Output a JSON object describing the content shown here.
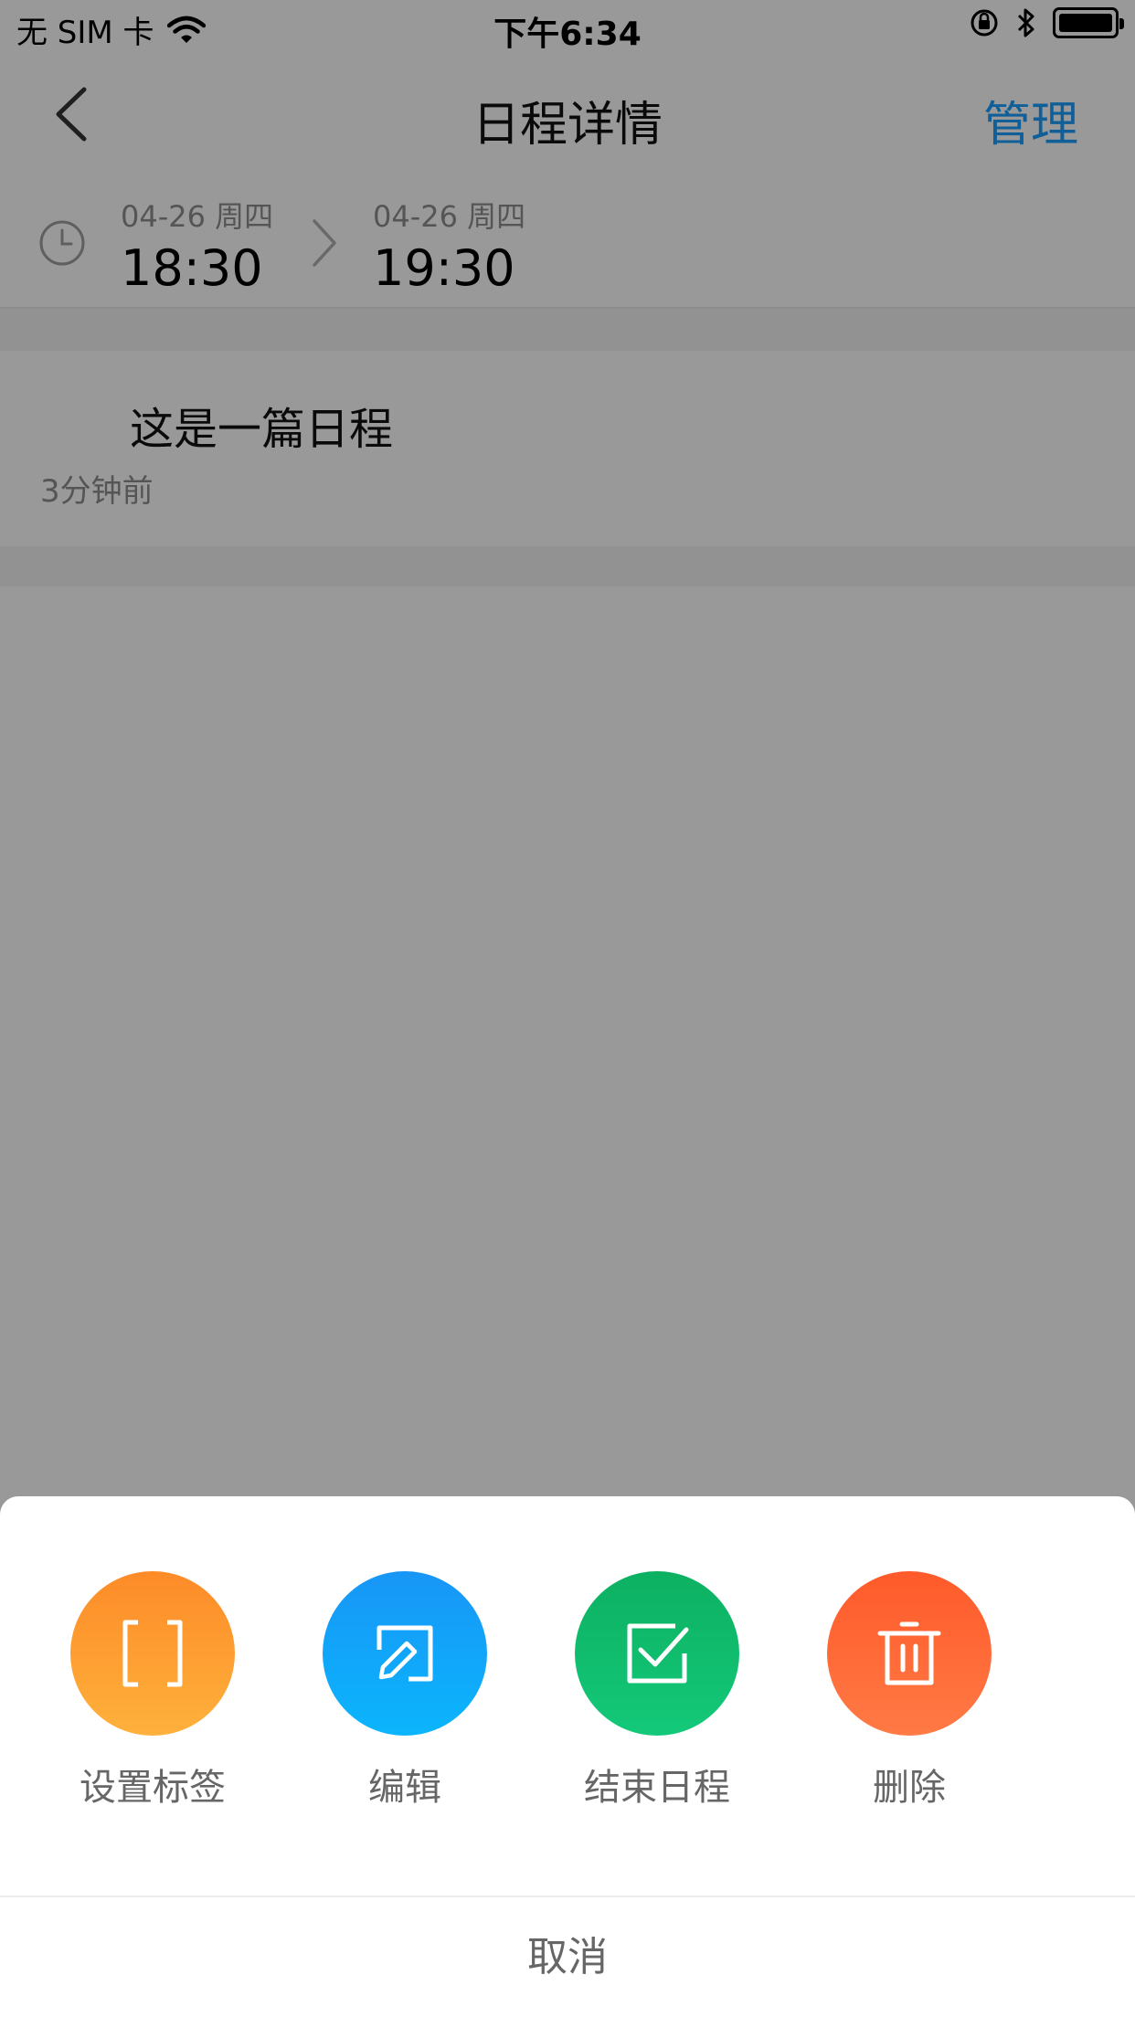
{
  "status_bar": {
    "carrier": "无 SIM 卡",
    "time": "下午6:34"
  },
  "nav": {
    "title": "日程详情",
    "manage": "管理"
  },
  "schedule": {
    "start": {
      "date": "04-26 周四",
      "time": "18:30"
    },
    "end": {
      "date": "04-26 周四",
      "time": "19:30"
    },
    "title": "这是一篇日程",
    "updated": "3分钟前"
  },
  "actions": [
    {
      "label": "设置标签",
      "icon": "tag-bracket-icon",
      "color": "#fd8b28"
    },
    {
      "label": "编辑",
      "icon": "edit-icon",
      "color": "#1896f7"
    },
    {
      "label": "结束日程",
      "icon": "check-box-icon",
      "color": "#0db061"
    },
    {
      "label": "删除",
      "icon": "trash-icon",
      "color": "#ff5a2a"
    }
  ],
  "cancel": "取消"
}
